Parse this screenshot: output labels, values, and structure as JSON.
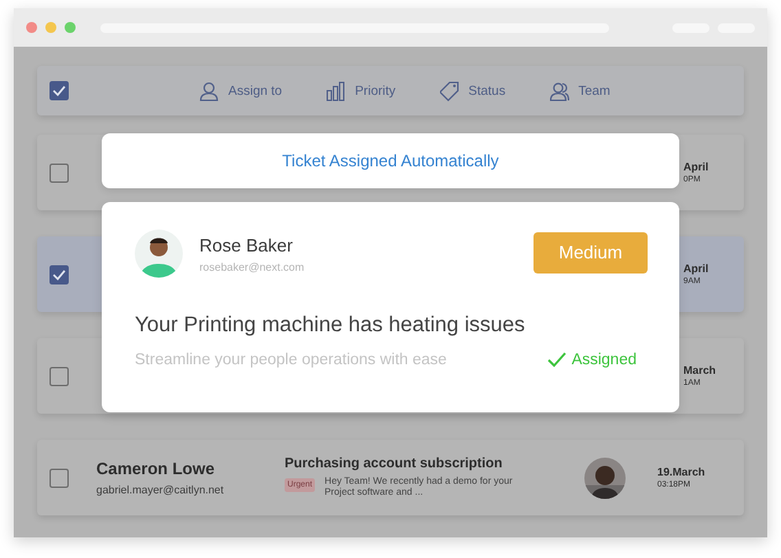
{
  "toolbar": {
    "select_all": {
      "checked": true
    },
    "actions": [
      {
        "label": "Assign to",
        "kind": "person"
      },
      {
        "label": "Priority",
        "kind": "bars"
      },
      {
        "label": "Status",
        "kind": "tag"
      },
      {
        "label": "Team",
        "kind": "team"
      }
    ]
  },
  "tickets": [
    {
      "kind": "partial",
      "checked": false,
      "selected": false,
      "date": "April",
      "time": "0PM"
    },
    {
      "kind": "partial",
      "checked": true,
      "selected": true,
      "date": "April",
      "time": "9AM"
    },
    {
      "kind": "partial",
      "checked": false,
      "selected": false,
      "date": "March",
      "time": "1AM"
    },
    {
      "kind": "full",
      "checked": false,
      "selected": false,
      "name": "Cameron Lowe",
      "email": "gabriel.mayer@caitlyn.net",
      "subject": "Purchasing account subscription",
      "tag": "Urgent",
      "preview": "Hey Team! We recently had a demo for your Project software and ...",
      "date": "19.March",
      "time": "03:18PM"
    }
  ],
  "notification": {
    "title": "Ticket Assigned Automatically"
  },
  "assignment": {
    "name": "Rose Baker",
    "email": "rosebaker@next.com",
    "priority": "Medium",
    "issue": "Your Printing machine has heating issues",
    "description": "Streamline your people operations with ease",
    "status": "Assigned"
  }
}
